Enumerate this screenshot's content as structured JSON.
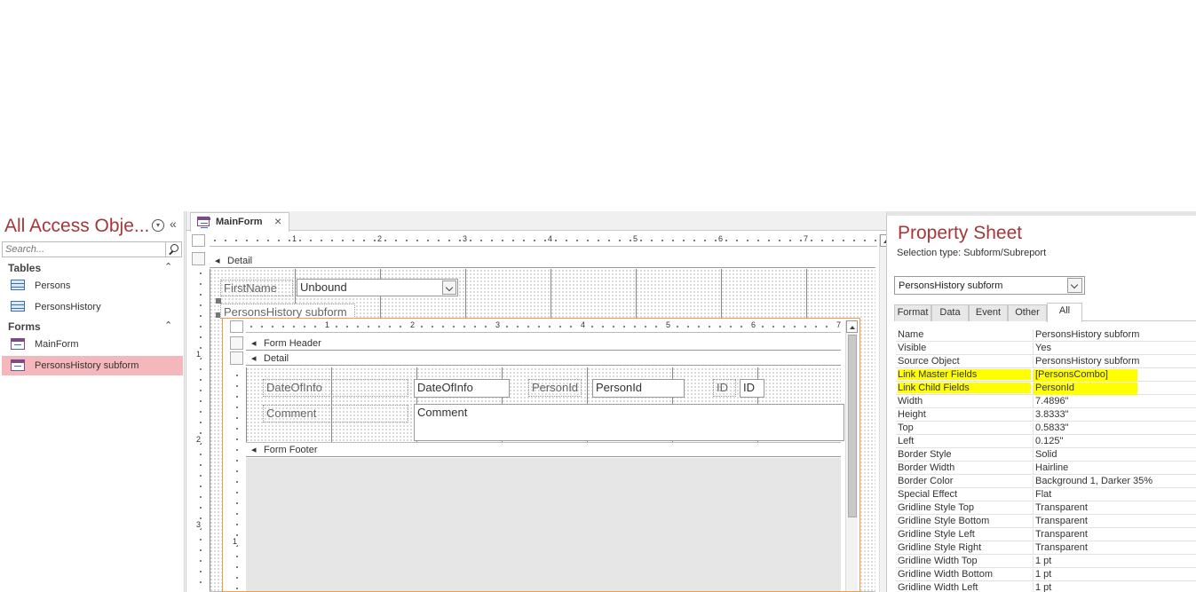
{
  "nav": {
    "title": "All Access Obje...",
    "search_placeholder": "Search...",
    "groups": [
      {
        "label": "Tables",
        "items": [
          "Persons",
          "PersonsHistory"
        ]
      },
      {
        "label": "Forms",
        "items": [
          "MainForm",
          "PersonsHistory subform"
        ]
      }
    ],
    "selected_item": "PersonsHistory subform"
  },
  "document": {
    "tab_label": "MainForm",
    "ruler_ticks": [
      "1",
      "2",
      "3",
      "4",
      "5",
      "6",
      "7"
    ],
    "vruler_ticks": [
      "1",
      "2",
      "3"
    ],
    "main_form": {
      "detail_label": "Detail",
      "firstname_label": "FirstName",
      "firstname_value": "Unbound",
      "subform_label": "PersonsHistory subform"
    },
    "subform": {
      "ruler_ticks": [
        "1",
        "2",
        "3",
        "4",
        "5",
        "6",
        "7"
      ],
      "vruler_tick": "1",
      "form_header_label": "Form Header",
      "detail_label": "Detail",
      "form_footer_label": "Form Footer",
      "controls": {
        "dateofinfo_label": "DateOfInfo",
        "dateofinfo_field": "DateOfInfo",
        "personid_label": "PersonId",
        "personid_field": "PersonId",
        "id_label": "ID",
        "id_field": "ID",
        "comment_label": "Comment",
        "comment_field": "Comment"
      }
    }
  },
  "property_sheet": {
    "title": "Property Sheet",
    "selection_type": "Selection type:  Subform/Subreport",
    "selected_object": "PersonsHistory subform",
    "tabs": [
      "Format",
      "Data",
      "Event",
      "Other",
      "All"
    ],
    "active_tab": "All",
    "highlight_color": "#ffff00",
    "rows": [
      {
        "name": "Name",
        "value": "PersonsHistory subform"
      },
      {
        "name": "Visible",
        "value": "Yes"
      },
      {
        "name": "Source Object",
        "value": "PersonsHistory subform"
      },
      {
        "name": "Link Master Fields",
        "value": "[PersonsCombo]",
        "highlighted": true
      },
      {
        "name": "Link Child Fields",
        "value": "PersonId",
        "highlighted": true
      },
      {
        "name": "Width",
        "value": "7.4896\""
      },
      {
        "name": "Height",
        "value": "3.8333\""
      },
      {
        "name": "Top",
        "value": "0.5833\""
      },
      {
        "name": "Left",
        "value": "0.125\""
      },
      {
        "name": "Border Style",
        "value": "Solid"
      },
      {
        "name": "Border Width",
        "value": "Hairline"
      },
      {
        "name": "Border Color",
        "value": "Background 1, Darker 35%"
      },
      {
        "name": "Special Effect",
        "value": "Flat"
      },
      {
        "name": "Gridline Style Top",
        "value": "Transparent"
      },
      {
        "name": "Gridline Style Bottom",
        "value": "Transparent"
      },
      {
        "name": "Gridline Style Left",
        "value": "Transparent"
      },
      {
        "name": "Gridline Style Right",
        "value": "Transparent"
      },
      {
        "name": "Gridline Width Top",
        "value": "1 pt"
      },
      {
        "name": "Gridline Width Bottom",
        "value": "1 pt"
      },
      {
        "name": "Gridline Width Left",
        "value": "1 pt"
      }
    ]
  },
  "colors": {
    "accent_title": "#a4373a",
    "selection": "#f4b8bc",
    "subform_border": "#e8a04a"
  }
}
